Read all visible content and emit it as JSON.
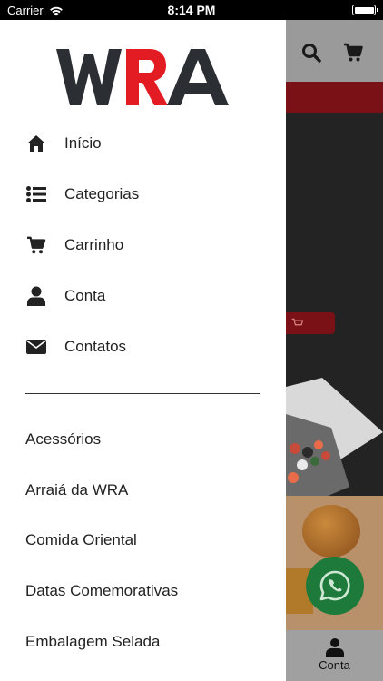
{
  "status_bar": {
    "carrier": "Carrier",
    "time": "8:14 PM"
  },
  "brand": {
    "logo_text": "WRA",
    "colors": {
      "dark": "#2b2f34",
      "red": "#e31b23"
    }
  },
  "drawer": {
    "nav": [
      {
        "label": "Início",
        "icon": "home-icon"
      },
      {
        "label": "Categorias",
        "icon": "list-icon"
      },
      {
        "label": "Carrinho",
        "icon": "cart-icon"
      },
      {
        "label": "Conta",
        "icon": "user-icon"
      },
      {
        "label": "Contatos",
        "icon": "envelope-icon"
      }
    ],
    "categories": [
      "Acessórios",
      "Arraiá da WRA",
      "Comida Oriental",
      "Datas Comemorativas",
      "Embalagem Selada"
    ]
  },
  "background_app": {
    "tab_label": "Conta",
    "whatsapp_icon": "whatsapp-icon",
    "accent_color": "#7a1116"
  }
}
